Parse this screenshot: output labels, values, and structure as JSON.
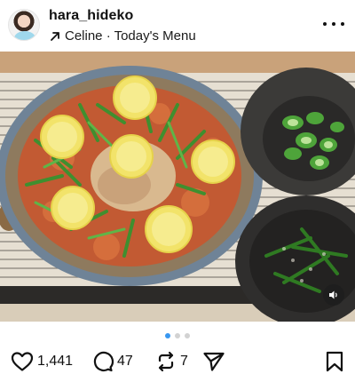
{
  "post": {
    "username": "hara_hideko",
    "location_line": "Celine · Today's Menu",
    "carousel": {
      "current": 1,
      "total": 3
    }
  },
  "stats": {
    "likes": "1,441",
    "comments": "47",
    "reposts": "7"
  },
  "icons": {
    "more": "more-horizontal-icon",
    "location": "arrow-up-right-icon",
    "like": "heart-icon",
    "comment": "comment-bubble-icon",
    "repost": "repost-icon",
    "share": "send-icon",
    "save": "bookmark-icon",
    "sound": "speaker-icon"
  },
  "colors": {
    "carousel_active": "#3897f0",
    "carousel_inactive": "#d2d2d2"
  }
}
